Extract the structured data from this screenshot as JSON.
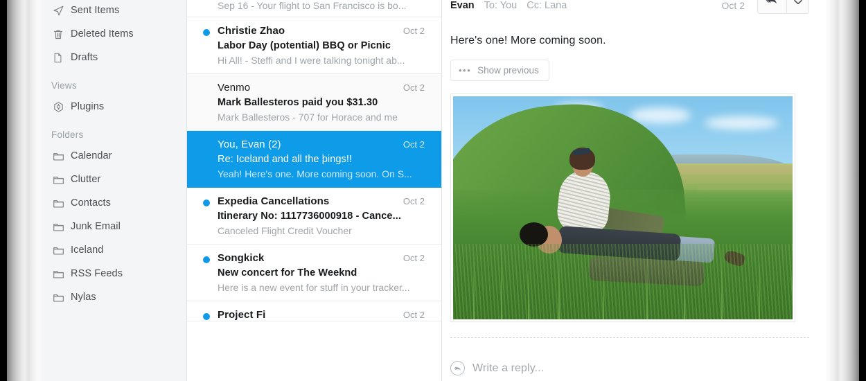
{
  "colors": {
    "selection_blue": "#0e9ce8",
    "unread_dot": "#0f9ae8",
    "sidebar_bg": "#f4f5f6",
    "text_primary": "#17191b",
    "text_muted": "#a0a5a9"
  },
  "sidebar": {
    "items": [
      {
        "label": "Sent Items",
        "icon": "paper-plane-icon",
        "type": "item"
      },
      {
        "label": "Deleted Items",
        "icon": "trash-icon",
        "type": "item"
      },
      {
        "label": "Drafts",
        "icon": "document-icon",
        "type": "item"
      },
      {
        "label": "Views",
        "icon": "",
        "type": "header"
      },
      {
        "label": "Plugins",
        "icon": "plugin-icon",
        "type": "item"
      },
      {
        "label": "Folders",
        "icon": "",
        "type": "header"
      },
      {
        "label": "Calendar",
        "icon": "folder-icon",
        "type": "item"
      },
      {
        "label": "Clutter",
        "icon": "folder-icon",
        "type": "item"
      },
      {
        "label": "Contacts",
        "icon": "folder-icon",
        "type": "item"
      },
      {
        "label": "Junk Email",
        "icon": "folder-icon",
        "type": "item"
      },
      {
        "label": "Iceland",
        "icon": "folder-icon",
        "type": "item"
      },
      {
        "label": "RSS Feeds",
        "icon": "folder-icon",
        "type": "item"
      },
      {
        "label": "Nylas",
        "icon": "folder-icon",
        "type": "item"
      }
    ]
  },
  "thread_list": {
    "rows": [
      {
        "from": "",
        "date": "",
        "subject": "",
        "snippet": "Sep 16 - Your flight to San Francisco is bo...",
        "state": "partial-top",
        "unread": false,
        "selected": false
      },
      {
        "from": "Christie Zhao",
        "date": "Oct 2",
        "subject": "Labor Day (potential) BBQ or Picnic",
        "snippet": "Hi All! - Steffi and I were talking tonight ab...",
        "state": "normal",
        "unread": true,
        "selected": false
      },
      {
        "from": "Venmo",
        "date": "Oct 2",
        "subject": "Mark Ballesteros paid you $31.30",
        "snippet": "Mark Ballesteros - 707 for Horace and me",
        "state": "normal",
        "unread": false,
        "selected": false
      },
      {
        "from": "You, Evan (2)",
        "date": "Oct 2",
        "subject": "Re: Iceland and all the þings!!",
        "snippet": "Yeah! Here's one. More coming soon. On S...",
        "state": "normal",
        "unread": false,
        "selected": true
      },
      {
        "from": "Expedia Cancellations",
        "date": "Oct 2",
        "subject": "Itinerary No: 1117736000918 - Cance...",
        "snippet": "Canceled Flight Credit Voucher",
        "state": "normal",
        "unread": true,
        "selected": false
      },
      {
        "from": "Songkick",
        "date": "Oct 2",
        "subject": "New concert for The Weeknd",
        "snippet": "Here is a new event for stuff in your tracker...",
        "state": "normal",
        "unread": true,
        "selected": false
      },
      {
        "from": "Project Fi",
        "date": "Oct 2",
        "subject": "",
        "snippet": "",
        "state": "partial-bottom",
        "unread": true,
        "selected": false
      }
    ]
  },
  "reading_pane": {
    "header": {
      "from": "Evan",
      "to": "To: You",
      "cc": "Cc: Lana",
      "date": "Oct 2",
      "reply_icon": "reply-all-icon",
      "caret_icon": "chevron-down-icon"
    },
    "body": "Here's one! More coming soon.",
    "show_previous": {
      "dots": "•••",
      "label": "Show previous"
    },
    "attachment": {
      "alt": "Photo of two people resting on a grassy Icelandic hillside overlooking farmland"
    },
    "composer": {
      "icon": "reply-circle-icon",
      "placeholder": "Write a reply..."
    }
  }
}
